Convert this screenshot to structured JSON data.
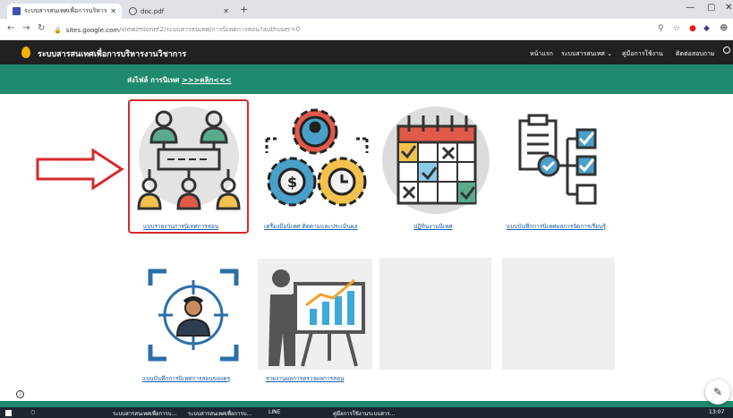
{
  "browser": {
    "tabs": [
      {
        "title": "ระบบสารสนเทศเพื่อการบริหารงานวิชาการ",
        "active": true
      },
      {
        "title": "doc.pdf",
        "active": false
      }
    ],
    "url_host": "sites.google.com",
    "url_path": "/view/mionet2/ระบบสารสนเทศ/การนิเทศการสอน?authuser=0"
  },
  "site": {
    "title": "ระบบสารสนเทศเพื่อการบริหารงานวิชาการ",
    "nav": [
      "หน้าแรก",
      "ระบบสารสนเทศ ⌄",
      "คู่มือการใช้งาน",
      "ติดต่อสอบถาม"
    ]
  },
  "banner": {
    "prefix": "ส่งไฟล์ การนิเทศ ",
    "link": ">>>คลิก<<<"
  },
  "cards": [
    {
      "icon": "org-chart-icon",
      "caption": "แบบรายงานการนิเทศการสอน",
      "highlighted": true
    },
    {
      "icon": "gears-person-icon",
      "caption": "เครื่องมือนิเทศ ติดตามและประเมินผล"
    },
    {
      "icon": "calendar-icon",
      "caption": "ปฏิทินงานนิเทศ"
    },
    {
      "icon": "checklist-icon",
      "caption": "แบบบันทึกการนิเทศผลการจัดการเรียนรู้"
    },
    {
      "icon": "target-person-icon",
      "caption": "แบบบันทึกการนิเทศการสอนของครู"
    },
    {
      "icon": "presentation-icon",
      "caption": "รายงานผลการตรวจผลการสอน"
    }
  ],
  "colors": {
    "banner": "#1f8a6d",
    "header": "#212121",
    "highlight": "#d62a2a"
  },
  "taskbar": {
    "items": [
      "ระบบสารสนเทศเพื่อการบ...",
      "ระบบสารสนเทศเพื่อการบ...",
      "LINE",
      "คู่มือการใช้งานระบบสาร..."
    ],
    "clock": "13:07"
  }
}
